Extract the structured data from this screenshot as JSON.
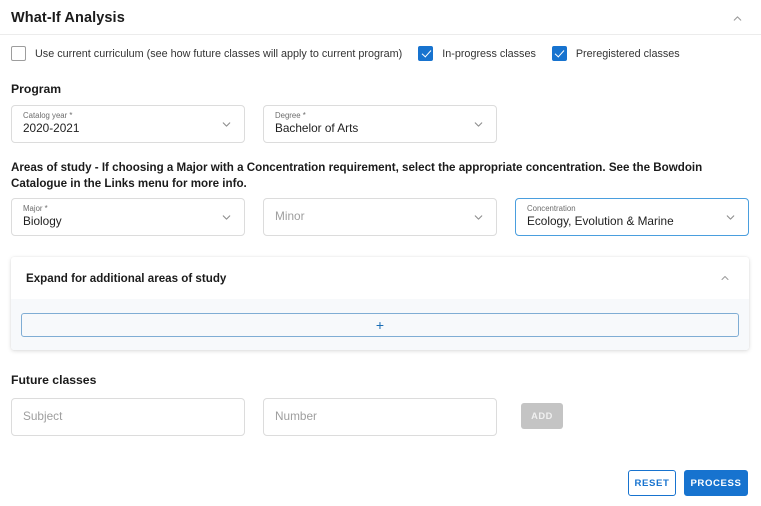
{
  "header": {
    "title": "What-If Analysis",
    "collapse_icon": "chevron-up-icon"
  },
  "options": {
    "use_current_curriculum": {
      "label": "Use current curriculum (see how future classes will apply to current program)",
      "checked": false
    },
    "in_progress_classes": {
      "label": "In-progress classes",
      "checked": true
    },
    "preregistered_classes": {
      "label": "Preregistered classes",
      "checked": true
    }
  },
  "program": {
    "section_label": "Program",
    "catalog_year": {
      "label": "Catalog year *",
      "value": "2020-2021"
    },
    "degree": {
      "label": "Degree *",
      "value": "Bachelor of Arts"
    }
  },
  "areas_of_study": {
    "description": "Areas of study - If choosing a Major with a Concentration requirement, select the appropriate concentration. See the Bowdoin Catalogue in the Links menu for more info.",
    "major": {
      "label": "Major *",
      "value": "Biology"
    },
    "minor": {
      "label": "",
      "placeholder": "Minor",
      "value": ""
    },
    "concentration": {
      "label": "Concentration",
      "value": "Ecology, Evolution & Marine",
      "focused": true
    },
    "expand_panel": {
      "title": "Expand for additional areas of study",
      "collapse_icon": "chevron-up-icon",
      "add_icon": "plus-icon"
    }
  },
  "future_classes": {
    "section_label": "Future classes",
    "subject": {
      "placeholder": "Subject",
      "value": ""
    },
    "number": {
      "placeholder": "Number",
      "value": ""
    },
    "add_label": "ADD"
  },
  "footer": {
    "reset_label": "RESET",
    "process_label": "PROCESS"
  },
  "colors": {
    "accent_blue": "#1773cf",
    "focus_blue": "#4a9ede",
    "disabled_gray": "#c4c4c4",
    "panel_body_bg": "#f7f9fb"
  }
}
